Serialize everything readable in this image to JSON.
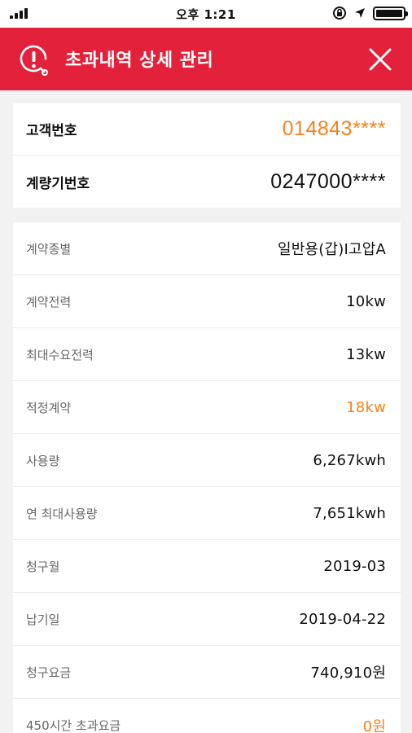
{
  "status_bar": {
    "time": "오후 1:21"
  },
  "header": {
    "title": "초과내역 상세 관리",
    "accent_color": "#e4213a"
  },
  "top_card": {
    "customer_label": "고객번호",
    "customer_number": "014843****",
    "meter_label": "계량기번호",
    "meter_number": "0247000****"
  },
  "details": [
    {
      "label": "계약종별",
      "value": "일반용(갑)I고압A"
    },
    {
      "label": "계약전력",
      "value": "10kw"
    },
    {
      "label": "최대수요전력",
      "value": "13kw"
    },
    {
      "label": "적정계약",
      "value": "18kw",
      "highlight": true
    },
    {
      "label": "사용량",
      "value": "6,267kwh"
    },
    {
      "label": "연 최대사용량",
      "value": "7,651kwh"
    },
    {
      "label": "청구월",
      "value": "2019-03"
    },
    {
      "label": "납기일",
      "value": "2019-04-22"
    },
    {
      "label": "청구요금",
      "value": "740,910원"
    },
    {
      "label": "450시간 초과요금",
      "value": "0원",
      "highlight": true
    }
  ],
  "colors": {
    "highlight": "#f5821f",
    "background": "#f2f2f2"
  },
  "icons": {
    "header_left": "alert-plug-icon",
    "header_right": "close-icon"
  }
}
